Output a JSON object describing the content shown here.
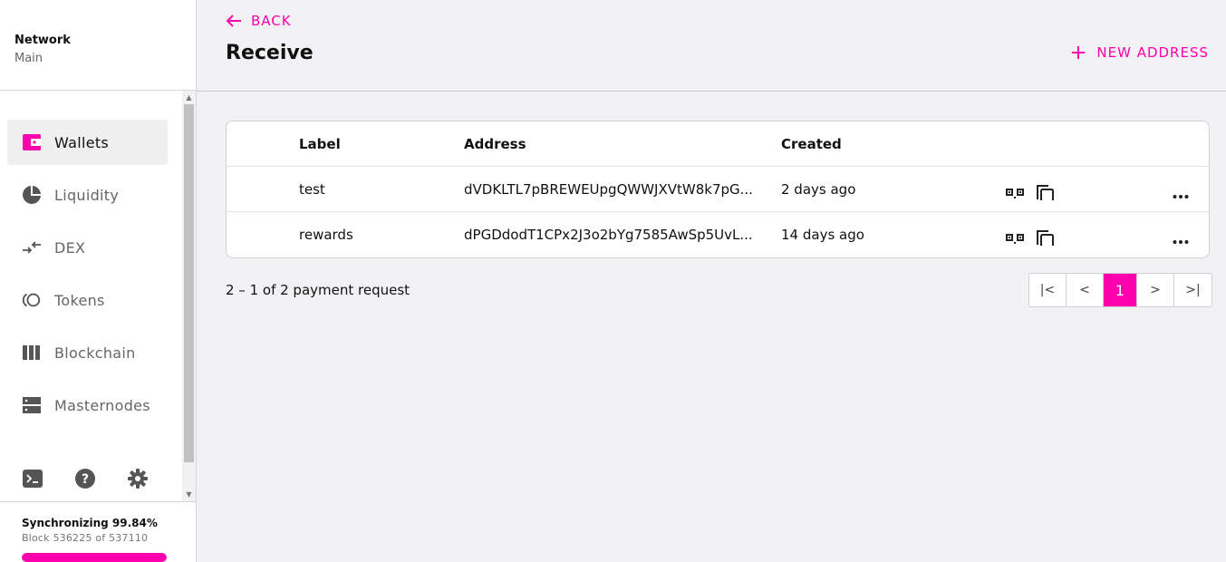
{
  "network": {
    "label": "Network",
    "value": "Main"
  },
  "nav": [
    {
      "label": "Wallets",
      "icon": "wallet-icon",
      "active": true
    },
    {
      "label": "Liquidity",
      "icon": "pie-chart-icon"
    },
    {
      "label": "DEX",
      "icon": "swap-arrows-icon"
    },
    {
      "label": "Tokens",
      "icon": "tokens-icon"
    },
    {
      "label": "Blockchain",
      "icon": "blockchain-bars-icon"
    },
    {
      "label": "Masternodes",
      "icon": "server-icon"
    }
  ],
  "tools": [
    "terminal-icon",
    "help-icon",
    "settings-gear-icon"
  ],
  "sync": {
    "title": "Synchronizing 99.84%",
    "block": "Block 536225 of 537110",
    "progress": 0.9984
  },
  "header": {
    "back_label": "BACK",
    "title": "Receive",
    "new_address_label": "NEW ADDRESS"
  },
  "table": {
    "columns": [
      "Label",
      "Address",
      "Created"
    ],
    "rows": [
      {
        "label": "test",
        "address": "dVDKLTL7pBREWEUpgQWWJXVtW8k7pG...",
        "created": "2 days ago"
      },
      {
        "label": "rewards",
        "address": "dPGDdodT1CPx2J3o2bYg7585AwSp5UvL...",
        "created": "14 days ago"
      }
    ]
  },
  "footer": {
    "summary": "2 – 1 of 2 payment request"
  },
  "pagination": {
    "first": "|<",
    "prev": "<",
    "current": "1",
    "next": ">",
    "last": ">|"
  },
  "colors": {
    "accent": "#ff00af"
  }
}
